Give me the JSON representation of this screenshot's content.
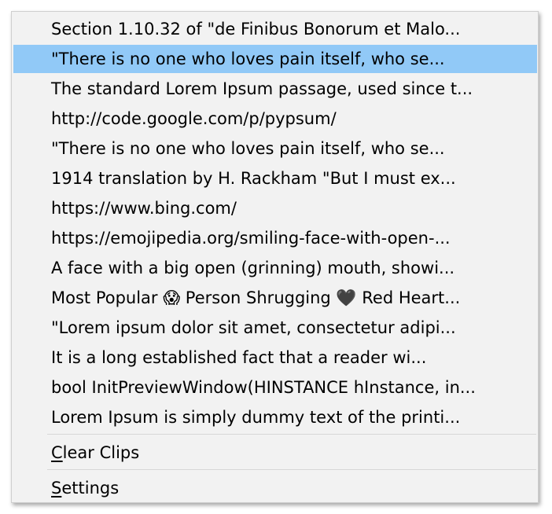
{
  "clips": [
    {
      "label": "Section 1.10.32 of \"de Finibus Bonorum et Malo..."
    },
    {
      "label": "\"There is no one who loves pain itself, who se..."
    },
    {
      "label": "The standard Lorem Ipsum passage, used since t..."
    },
    {
      "label": "http://code.google.com/p/pypsum/"
    },
    {
      "label": "\"There is no one who loves pain itself, who se..."
    },
    {
      "label": "1914 translation by H. Rackham  \"But I must ex..."
    },
    {
      "label": "https://www.bing.com/"
    },
    {
      "label": "https://emojipedia.org/smiling-face-with-open-..."
    },
    {
      "label": "A face with a big open (grinning) mouth, showi..."
    },
    {
      "label": "Most Popular 😱 Person Shrugging  🖤 Red Heart..."
    },
    {
      "label": "\"Lorem ipsum dolor sit amet, consectetur adipi..."
    },
    {
      "label": "It is a long established fact that a reader wi..."
    },
    {
      "label": "bool InitPreviewWindow(HINSTANCE hInstance, in..."
    },
    {
      "label": "Lorem Ipsum is simply dummy text of the printi..."
    }
  ],
  "actions": {
    "clear_clips": {
      "mnemonic": "C",
      "rest": "lear Clips"
    },
    "settings": {
      "mnemonic": "S",
      "rest": "ettings"
    }
  },
  "colors": {
    "highlight": "#91c9f7",
    "menu_background": "#f2f2f2",
    "separator": "#d7d7d7"
  },
  "state": {
    "highlighted_index": 1
  }
}
